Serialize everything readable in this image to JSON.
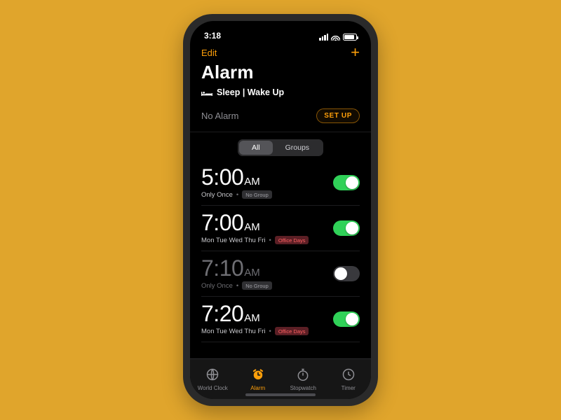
{
  "colors": {
    "accent": "#fe9f0a",
    "bg": "#e0a52c",
    "toggle_on": "#30d158"
  },
  "status": {
    "time": "3:18"
  },
  "nav": {
    "edit": "Edit",
    "add": "+"
  },
  "header": {
    "title": "Alarm",
    "sleep_label": "Sleep | Wake Up",
    "no_alarm": "No Alarm",
    "setup": "SET UP"
  },
  "segment": {
    "options": [
      "All",
      "Groups"
    ],
    "selected": 0
  },
  "alarms": [
    {
      "time": "5:00",
      "ampm": "AM",
      "repeat": "Only Once",
      "group": "No Group",
      "group_style": "plain",
      "on": true
    },
    {
      "time": "7:00",
      "ampm": "AM",
      "repeat": "Mon Tue Wed Thu Fri",
      "group": "Office Days",
      "group_style": "red",
      "on": true
    },
    {
      "time": "7:10",
      "ampm": "AM",
      "repeat": "Only Once",
      "group": "No Group",
      "group_style": "plain",
      "on": false
    },
    {
      "time": "7:20",
      "ampm": "AM",
      "repeat": "Mon Tue Wed Thu Fri",
      "group": "Office Days",
      "group_style": "red",
      "on": true
    }
  ],
  "tabs": [
    {
      "id": "world-clock",
      "label": "World Clock"
    },
    {
      "id": "alarm",
      "label": "Alarm"
    },
    {
      "id": "stopwatch",
      "label": "Stopwatch"
    },
    {
      "id": "timer",
      "label": "Timer"
    }
  ],
  "active_tab": 1
}
